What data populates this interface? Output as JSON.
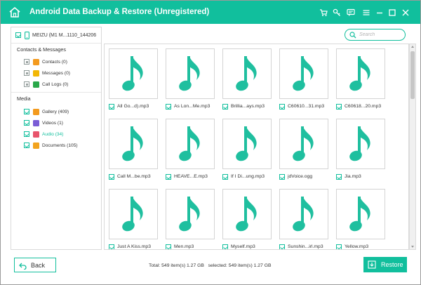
{
  "window": {
    "title": "Android Data Backup & Restore (Unregistered)",
    "toolbar_icons": [
      "cart-icon",
      "key-icon",
      "feedback-icon",
      "menu-icon",
      "minimize-icon",
      "maximize-icon",
      "close-icon"
    ],
    "accent_color": "#11bf9d"
  },
  "sidebar": {
    "device": "MEIZU (M1 M...1110_144206",
    "sections": [
      {
        "title": "Contacts & Messages",
        "items": [
          {
            "label": "Contacts (0)",
            "icon": "contacts-icon",
            "icon_color": "#f39a1e",
            "state": "partial"
          },
          {
            "label": "Messages (0)",
            "icon": "messages-icon",
            "icon_color": "#f2b705",
            "state": "partial"
          },
          {
            "label": "Call Logs (0)",
            "icon": "call-logs-icon",
            "icon_color": "#2aa84a",
            "state": "partial"
          }
        ]
      },
      {
        "title": "Media",
        "items": [
          {
            "label": "Gallery (409)",
            "icon": "gallery-icon",
            "icon_color": "#f39a1e",
            "state": "checked"
          },
          {
            "label": "Videos (1)",
            "icon": "videos-icon",
            "icon_color": "#7b5cd6",
            "state": "checked"
          },
          {
            "label": "Audio (34)",
            "icon": "audio-icon",
            "icon_color": "#e8546b",
            "state": "checked",
            "selected": true
          },
          {
            "label": "Documents (105)",
            "icon": "documents-icon",
            "icon_color": "#f2a31e",
            "state": "checked"
          }
        ]
      }
    ]
  },
  "search": {
    "placeholder": "Search",
    "value": ""
  },
  "files": [
    "All Go...d).mp3",
    "As Lon...Me.mp3",
    "Brillia...ays.mp3",
    "C60610...31.mp3",
    "C60618...20.mp3",
    "Call M...be.mp3",
    "HEAVE...E.mp3",
    "If I Di...ung.mp3",
    "jdVoice.ogg",
    "Jia.mp3",
    "Just A Kiss.mp3",
    "Men.mp3",
    "Myself.mp3",
    "Sunshin...irl.mp3",
    "Yellow.mp3"
  ],
  "file_icon": "music-note-icon",
  "file_icon_color": "#1fbf9f",
  "footer": {
    "back_label": "Back",
    "totals": "Total: 549 item(s) 1.27 GB   selected: 549 item(s) 1.27 GB",
    "restore_label": "Restore"
  }
}
